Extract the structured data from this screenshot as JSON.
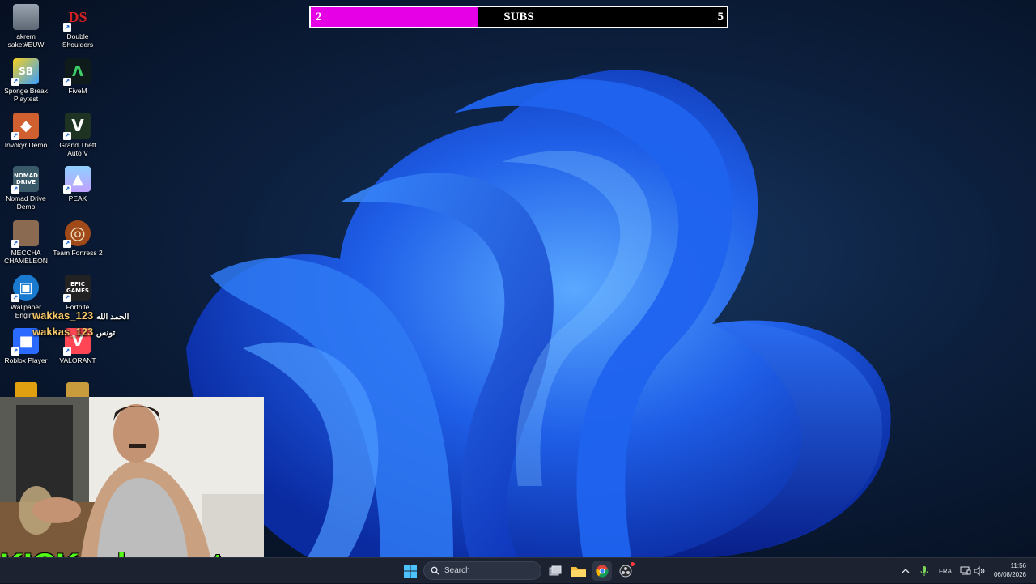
{
  "desktop": {
    "icons": [
      {
        "label": "akrem saket#EUW",
        "icon": "recycle-bin-icon"
      },
      {
        "label": "Double Shoulders",
        "icon": "ds-logo-icon",
        "glyph": "DS"
      },
      {
        "label": "Sponge Break Playtest",
        "icon": "sponge-break-icon",
        "glyph": "SB"
      },
      {
        "label": "FiveM",
        "icon": "fivem-icon"
      },
      {
        "label": "Invokyr Demo",
        "icon": "invokyr-icon"
      },
      {
        "label": "Grand Theft Auto V",
        "icon": "gta-v-icon"
      },
      {
        "label": "Nomad Drive Demo",
        "icon": "nomad-drive-icon",
        "glyph": "NOMAD DRIVE"
      },
      {
        "label": "PEAK",
        "icon": "peak-icon"
      },
      {
        "label": "MECCHA CHAMELEON",
        "icon": "meccha-chameleon-icon"
      },
      {
        "label": "Team Fortress 2",
        "icon": "tf2-icon"
      },
      {
        "label": "Wallpaper Engine",
        "icon": "wallpaper-engine-icon"
      },
      {
        "label": "Fortnite",
        "icon": "epic-games-icon",
        "glyph": "EPIC GAMES"
      },
      {
        "label": "Roblox Player",
        "icon": "roblox-icon"
      },
      {
        "label": "VALORANT",
        "icon": "valorant-icon"
      }
    ]
  },
  "subs": {
    "current": "2",
    "label": "SUBS",
    "goal": "5",
    "progress": 0.4,
    "fill_color": "#e600e6"
  },
  "chat": [
    {
      "user": "wakkas_123",
      "message": "الحمد الله"
    },
    {
      "user": "wakkas_123",
      "message": "تونس"
    }
  ],
  "stream": {
    "kick_label": "KICK :akram_tn"
  },
  "taskbar": {
    "search_label": "Search",
    "language": "FRA",
    "time": "11:56",
    "date": "06/08/2026"
  }
}
